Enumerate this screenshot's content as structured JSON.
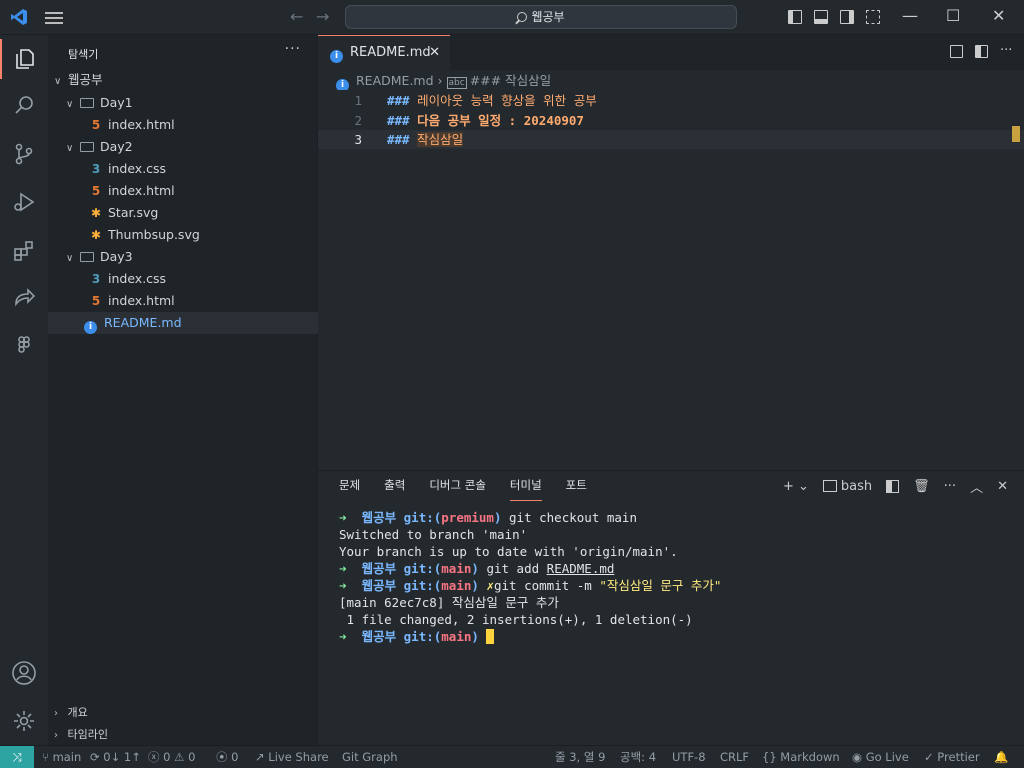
{
  "titlebar": {
    "search_text": "웹공부",
    "back": "←",
    "forward": "→",
    "minimize": "—",
    "maximize": "☐",
    "close": "✕"
  },
  "sidebar": {
    "title": "탐색기",
    "more": "···",
    "root": "웹공부",
    "items": [
      {
        "label": "Day1",
        "type": "folder"
      },
      {
        "label": "index.html",
        "type": "html"
      },
      {
        "label": "Day2",
        "type": "folder"
      },
      {
        "label": "index.css",
        "type": "css"
      },
      {
        "label": "index.html",
        "type": "html"
      },
      {
        "label": "Star.svg",
        "type": "svg"
      },
      {
        "label": "Thumbsup.svg",
        "type": "svg"
      },
      {
        "label": "Day3",
        "type": "folder"
      },
      {
        "label": "index.css",
        "type": "css"
      },
      {
        "label": "index.html",
        "type": "html"
      },
      {
        "label": "README.md",
        "type": "md"
      }
    ],
    "outline": "개요",
    "timeline": "타임라인"
  },
  "editor": {
    "tab_label": "README.md",
    "breadcrumb_file": "README.md",
    "breadcrumb_symbol": "### 작심삼일",
    "lines": [
      {
        "num": "1",
        "hash": "###",
        "text": "레이아웃 능력 향상을 위한 공부"
      },
      {
        "num": "2",
        "hash": "###",
        "text": "다음 공부 일정 : 20240907"
      },
      {
        "num": "3",
        "hash": "###",
        "text": "작심삼일"
      }
    ]
  },
  "panel": {
    "tabs": [
      "문제",
      "출력",
      "디버그 콘솔",
      "터미널",
      "포트"
    ],
    "shell": "bash",
    "terminal": {
      "dir": "웹공부",
      "line1_branch": "premium",
      "line1_cmd": "git checkout main",
      "line2": "Switched to branch 'main'",
      "line3": "Your branch is up to date with 'origin/main'.",
      "line4_branch": "main",
      "line4_cmd": "git add ",
      "line4_arg": "README.md",
      "line5_branch": "main",
      "line5_cmd": "git commit -m ",
      "line5_msg": "\"작심삼일 문구 추가\"",
      "line6": "[main 62ec7c8] 작심삼일 문구 추가",
      "line7": " 1 file changed, 2 insertions(+), 1 deletion(-)",
      "line8_branch": "main"
    }
  },
  "statusbar": {
    "branch": "main",
    "sync": "0↓ 1↑",
    "errors": "0",
    "warnings": "0",
    "ports": "0",
    "live_share": "Live Share",
    "git_graph": "Git Graph",
    "position": "줄 3, 열 9",
    "spaces": "공백: 4",
    "encoding": "UTF-8",
    "eol": "CRLF",
    "language": "Markdown",
    "go_live": "Go Live",
    "prettier": "Prettier"
  }
}
